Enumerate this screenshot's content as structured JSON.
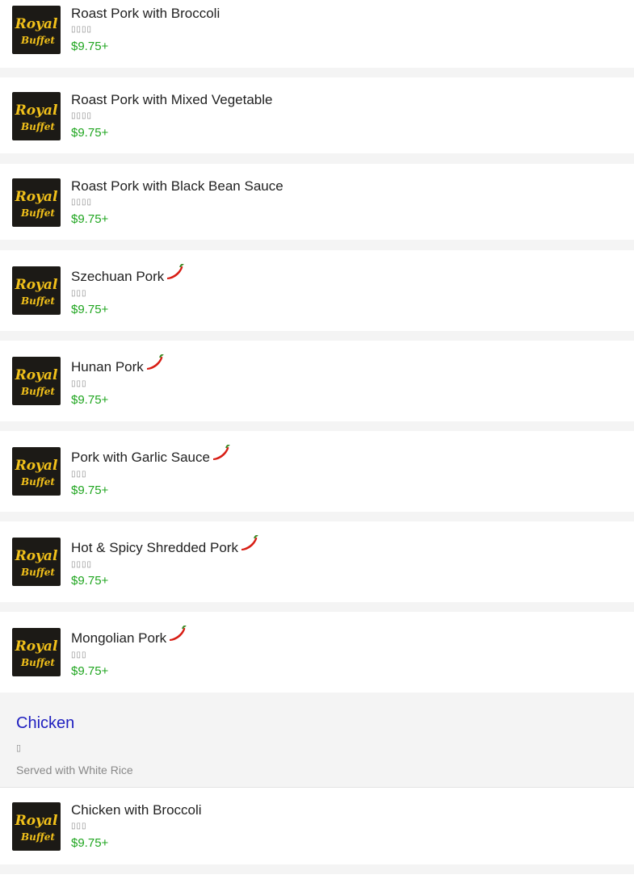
{
  "items": [
    {
      "name": "Roast Pork with Broccoli",
      "sub": "▯▯▯▯",
      "price": "$9.75+",
      "spicy": false
    },
    {
      "name": "Roast Pork with Mixed Vegetable",
      "sub": "▯▯▯▯",
      "price": "$9.75+",
      "spicy": false
    },
    {
      "name": "Roast Pork with Black Bean Sauce",
      "sub": "▯▯▯▯",
      "price": "$9.75+",
      "spicy": false
    },
    {
      "name": "Szechuan Pork",
      "sub": "▯▯▯",
      "price": "$9.75+",
      "spicy": true
    },
    {
      "name": "Hunan Pork",
      "sub": "▯▯▯",
      "price": "$9.75+",
      "spicy": true
    },
    {
      "name": "Pork with Garlic Sauce",
      "sub": "▯▯▯",
      "price": "$9.75+",
      "spicy": true
    },
    {
      "name": "Hot & Spicy Shredded Pork",
      "sub": "▯▯▯▯",
      "price": "$9.75+",
      "spicy": true
    },
    {
      "name": "Mongolian Pork",
      "sub": "▯▯▯",
      "price": "$9.75+",
      "spicy": true
    },
    {
      "name": "Chicken with Broccoli",
      "sub": "▯▯▯",
      "price": "$9.75+",
      "spicy": false
    }
  ],
  "logo": {
    "line1": "Royal",
    "line2": "Buffet",
    "bg": "#1c1a16",
    "text": "#f2c11a"
  },
  "section": {
    "title": "Chicken",
    "sub": "▯",
    "desc": "Served with White Rice"
  },
  "colors": {
    "price": "#1fa51f",
    "section_title": "#2020c0",
    "chili": "#d81d14"
  }
}
